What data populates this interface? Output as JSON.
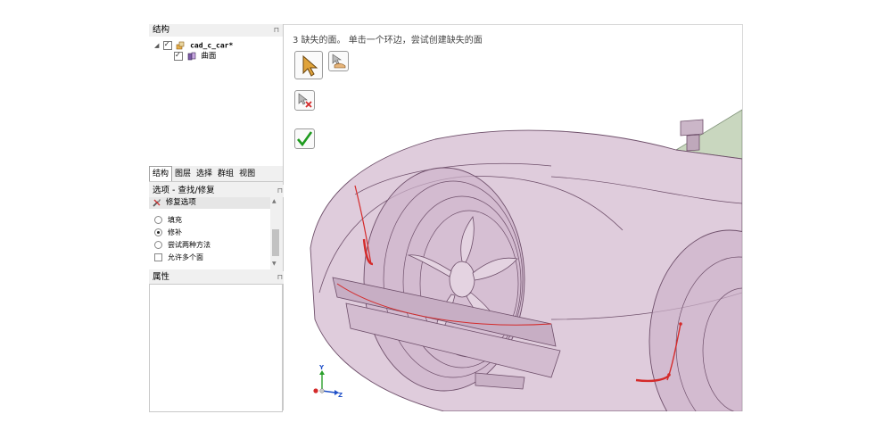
{
  "structure_panel": {
    "title": "结构",
    "tree": [
      {
        "label": "cad_c_car*",
        "checked": true,
        "icon": "assembly-icon"
      },
      {
        "label": "曲面",
        "checked": true,
        "icon": "surface-body-icon"
      }
    ]
  },
  "tabs": [
    {
      "label": "结构",
      "active": true
    },
    {
      "label": "图层",
      "active": false
    },
    {
      "label": "选择",
      "active": false
    },
    {
      "label": "群组",
      "active": false
    },
    {
      "label": "视图",
      "active": false
    }
  ],
  "options_panel": {
    "title": "选项 - 查找/修复",
    "section": "修复选项",
    "options": [
      {
        "label": "填充",
        "type": "radio",
        "selected": false
      },
      {
        "label": "修补",
        "type": "radio",
        "selected": true
      },
      {
        "label": "尝试两种方法",
        "type": "radio",
        "selected": false
      },
      {
        "label": "允许多个面",
        "type": "checkbox",
        "checked": false
      }
    ]
  },
  "properties_panel": {
    "title": "属性"
  },
  "viewport": {
    "status_message": "3 缺失的面。 单击一个环边，尝试创建缺失的面",
    "tools": [
      "select-arrow-icon",
      "select-edges-icon",
      "exclude-icon",
      "complete-checkmark-icon"
    ],
    "triad": {
      "y": "Y",
      "z": "Z"
    }
  },
  "colors": {
    "body": "#d9c3d6",
    "edge": "#6e4f6a",
    "missing_face": "#d42a2a",
    "check": "#1d9a1d"
  }
}
